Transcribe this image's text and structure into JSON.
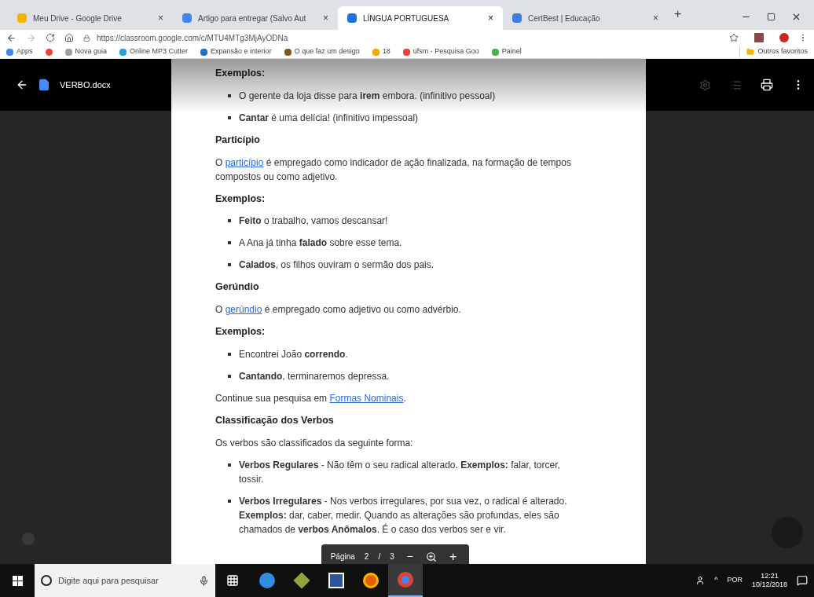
{
  "browser": {
    "tabs": [
      {
        "title": "Meu Drive - Google Drive",
        "kind": "drive",
        "selected": false
      },
      {
        "title": "Artigo para entregar (Salvo Aut",
        "kind": "doc",
        "selected": false
      },
      {
        "title": "LÍNGUA PORTUGUESA",
        "kind": "classroom",
        "selected": true
      },
      {
        "title": "CertBest | Educação",
        "kind": "cert",
        "selected": false
      }
    ],
    "close_mark": "×",
    "new_tab": "+",
    "url": "https://classroom.google.com/c/MTU4MTg3MjAyODNa",
    "bookmarks": [
      {
        "label": "Apps",
        "color": "#4285f4"
      },
      {
        "kind": "icon",
        "color": "#ea4335"
      },
      {
        "label": "Nova guia",
        "color": "#9e9e9e"
      },
      {
        "label": "Online MP3 Cutter",
        "color": "#2a9fd6"
      },
      {
        "label": "Expansão e interior",
        "color": "#1e6fc5"
      },
      {
        "label": "O que faz um design",
        "color": "#7a5c20"
      },
      {
        "label": "18",
        "color": "#f4a300"
      },
      {
        "label": "ufsm - Pesquisa Goo",
        "color": "#ea4335"
      },
      {
        "label": "Painel",
        "color": "#4caf50"
      }
    ],
    "other_bookmarks": "Outros favoritos"
  },
  "viewer": {
    "file_name": "VERBO.docx",
    "blocks": [
      {
        "kind": "heading",
        "text": "Exemplos:"
      },
      {
        "kind": "bullet",
        "text": "O gerente da loja disse para **irem** embora. (infinitivo pessoal)"
      },
      {
        "kind": "bullet",
        "text": "**Cantar** é uma delícia! (infinitivo impessoal)"
      },
      {
        "kind": "heading",
        "text": "Particípio"
      },
      {
        "kind": "para",
        "before": "O ",
        "link": "particípio",
        "after": " é empregado como indicador de ação finalizada, na formação de tempos compostos ou como adjetivo."
      },
      {
        "kind": "heading",
        "text": "Exemplos:"
      },
      {
        "kind": "bullet",
        "text": "**Feito** o trabalho, vamos descansar!"
      },
      {
        "kind": "bullet",
        "text": "A Ana já tinha **falado** sobre esse tema."
      },
      {
        "kind": "bullet",
        "text": "**Calados**, os filhos ouviram o sermão dos pais."
      },
      {
        "kind": "heading",
        "text": "Gerúndio"
      },
      {
        "kind": "para",
        "before": "O ",
        "link": "gerúndio",
        "after": " é empregado como adjetivo ou como advérbio."
      },
      {
        "kind": "heading",
        "text": "Exemplos:"
      },
      {
        "kind": "bullet",
        "text": "Encontrei João **correndo**."
      },
      {
        "kind": "bullet",
        "text": "**Cantando**, terminaremos depressa."
      },
      {
        "kind": "para",
        "before": "Continue sua pesquisa em ",
        "link": "Formas Nominais",
        "after": "."
      },
      {
        "kind": "heading",
        "text": "Classificação dos Verbos"
      },
      {
        "kind": "para",
        "before": "Os verbos são classificados da seguinte forma:"
      },
      {
        "kind": "bullet",
        "text": "**Verbos Regulares** - Não têm o seu radical alterado. **Exemplos:** falar, torcer, tossir."
      },
      {
        "kind": "bullet",
        "text": "**Verbos Irregulares** - Nos verbos irregulares, por sua vez, o radical é alterado. **Exemplos:** dar, caber, medir. Quando as alterações são profundas, eles são chamados de **verbos Anômalos**. É o caso dos verbos ser e vir."
      }
    ],
    "pager": {
      "label": "Página",
      "current": "2",
      "separator": "/",
      "total": "3",
      "minus": "−",
      "plus": "+"
    }
  },
  "taskbar": {
    "search_placeholder": "Digite aqui para pesquisar",
    "apps": [
      {
        "kind": "taskview"
      },
      {
        "kind": "edge"
      },
      {
        "kind": "cube"
      },
      {
        "kind": "word"
      },
      {
        "kind": "firefox"
      },
      {
        "kind": "chrome",
        "selected": true
      }
    ],
    "language": "POR",
    "time": "12:21",
    "date": "10/12/2018",
    "caret": "^"
  }
}
